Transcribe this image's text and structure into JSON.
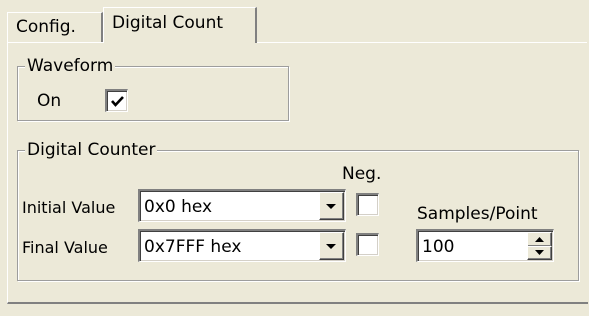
{
  "tabs": [
    {
      "label": "Config."
    },
    {
      "label": "Digital Count"
    }
  ],
  "waveform": {
    "title": "Waveform",
    "on_label": "On",
    "on_checked": true
  },
  "counter": {
    "title": "Digital Counter",
    "neg_label": "Neg.",
    "initial_label": "Initial Value",
    "initial_value": "0x0 hex",
    "initial_neg_checked": false,
    "final_label": "Final Value",
    "final_value": "0x7FFF hex",
    "final_neg_checked": false,
    "samples_label": "Samples/Point",
    "samples_value": "100"
  },
  "icons": {
    "dropdown": "chevron-down-icon",
    "spin": "spin-arrows-icon",
    "check": "checkmark-icon"
  }
}
